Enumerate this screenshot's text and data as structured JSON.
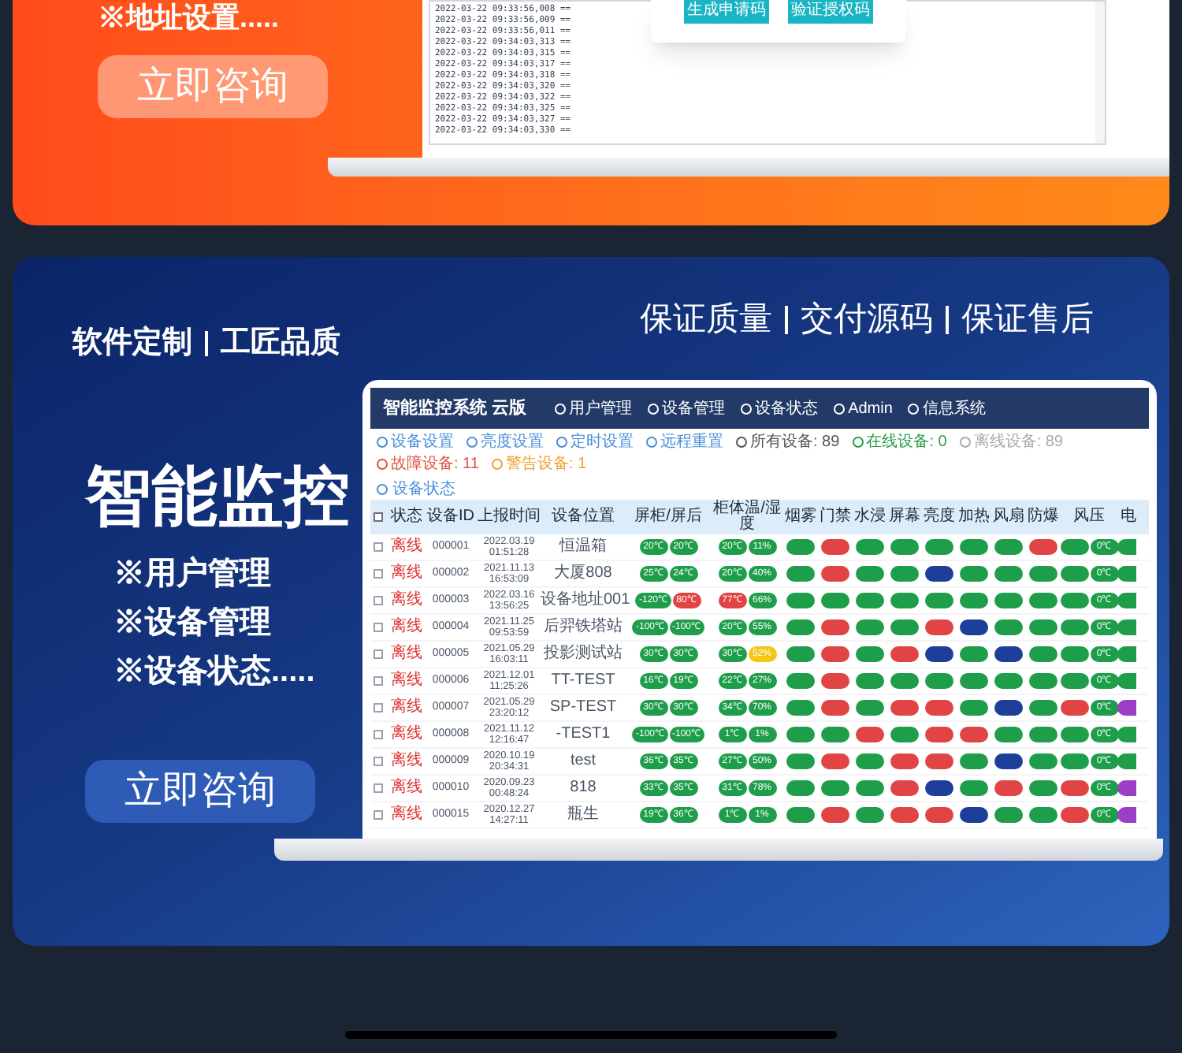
{
  "top_banner": {
    "feature_line": "※地址设置.....",
    "button": "立即咨询",
    "log_lines": [
      "2022-03-22 09:33:56,008 ==",
      "2022-03-22 09:33:56,009 ==",
      "2022-03-22 09:33:56,011 ==",
      "2022-03-22 09:34:03,313 ==",
      "2022-03-22 09:34:03,315 ==",
      "2022-03-22 09:34:03,317 ==",
      "2022-03-22 09:34:03,318 ==",
      "2022-03-22 09:34:03,320 ==",
      "2022-03-22 09:34:03,322 ==",
      "2022-03-22 09:34:03,325 ==",
      "2022-03-22 09:34:03,327 ==",
      "2022-03-22 09:34:03,330 =="
    ],
    "dialog_buttons": [
      "生成申请码",
      "验证授权码"
    ]
  },
  "blue_banner": {
    "tagline_left": [
      "软件定制",
      "工匠品质"
    ],
    "tagline_right": [
      "保证质量",
      "交付源码",
      "保证售后"
    ],
    "title": "智能监控",
    "features": [
      "※用户管理",
      "※设备管理",
      "※设备状态....."
    ],
    "button": "立即咨询",
    "app": {
      "title": "智能监控系统 云版",
      "nav": [
        "用户管理",
        "设备管理",
        "设备状态",
        "Admin",
        "信息系统"
      ],
      "toolbar": [
        {
          "label": "设备设置",
          "color": "#4a8fd9"
        },
        {
          "label": "亮度设置",
          "color": "#4a8fd9"
        },
        {
          "label": "定时设置",
          "color": "#4a8fd9"
        },
        {
          "label": "远程重置",
          "color": "#4a8fd9"
        },
        {
          "label": "所有设备: 89",
          "color": "#555555"
        },
        {
          "label": "在线设备: 0",
          "color": "#2a9d4a"
        },
        {
          "label": "离线设备: 89",
          "color": "#aaaaaa"
        },
        {
          "label": "故障设备: 11",
          "color": "#e05545"
        },
        {
          "label": "警告设备: 1",
          "color": "#f0a030"
        }
      ],
      "section": "设备状态",
      "all_checked": false,
      "columns": [
        "状态",
        "设备ID",
        "上报时间",
        "设备位置",
        "屏柜/屏后",
        "柜体温/湿度",
        "烟雾",
        "门禁",
        "水浸",
        "屏幕",
        "亮度",
        "加热",
        "风扇",
        "防爆",
        "风压",
        "电"
      ],
      "rows": [
        {
          "checked": false,
          "status": "离线",
          "id": "000001",
          "time": "2022.03.19 01:51:28",
          "location": "恒温箱",
          "temps": [
            {
              "value": "20℃",
              "color": "#1e9e4a"
            },
            {
              "value": "20℃",
              "color": "#1e9e4a"
            }
          ],
          "humid": [
            {
              "value": "20℃",
              "color": "#1e9e4a"
            },
            {
              "value": "11%",
              "color": "#1e9e4a"
            }
          ],
          "statuses": [
            {
              "color": "#1e9e4a"
            },
            {
              "color": "#e04444"
            },
            {
              "color": "#1e9e4a"
            },
            {
              "color": "#1e9e4a"
            },
            {
              "color": "#1e9e4a"
            },
            {
              "color": "#1e9e4a"
            },
            {
              "color": "#1e9e4a"
            },
            {
              "color": "#e04444"
            }
          ],
          "pressure": [
            {
              "color": "#1e9e4a"
            },
            {
              "value": "0℃",
              "color": "#1e9e4a"
            }
          ],
          "power": {
            "color": "#1e9e4a"
          }
        },
        {
          "checked": false,
          "status": "离线",
          "id": "000002",
          "time": "2021.11.13 16:53:09",
          "location": "大厦808",
          "temps": [
            {
              "value": "25℃",
              "color": "#1e9e4a"
            },
            {
              "value": "24℃",
              "color": "#1e9e4a"
            }
          ],
          "humid": [
            {
              "value": "20℃",
              "color": "#1e9e4a"
            },
            {
              "value": "40%",
              "color": "#1e9e4a"
            }
          ],
          "statuses": [
            {
              "color": "#1e9e4a"
            },
            {
              "color": "#e04444"
            },
            {
              "color": "#1e9e4a"
            },
            {
              "color": "#1e9e4a"
            },
            {
              "color": "#1d3f9a"
            },
            {
              "color": "#1e9e4a"
            },
            {
              "color": "#1e9e4a"
            },
            {
              "color": "#1e9e4a"
            }
          ],
          "pressure": [
            {
              "color": "#1e9e4a"
            },
            {
              "value": "0℃",
              "color": "#1e9e4a"
            }
          ],
          "power": {
            "color": "#1e9e4a"
          }
        },
        {
          "checked": false,
          "status": "离线",
          "id": "000003",
          "time": "2022.03.16 13:56:25",
          "location": "设备地址001",
          "temps": [
            {
              "value": "-120℃",
              "color": "#1e9e4a"
            },
            {
              "value": "80℃",
              "color": "#e04444"
            }
          ],
          "humid": [
            {
              "value": "77℃",
              "color": "#e04444"
            },
            {
              "value": "66%",
              "color": "#1e9e4a"
            }
          ],
          "statuses": [
            {
              "color": "#1e9e4a"
            },
            {
              "color": "#1e9e4a"
            },
            {
              "color": "#1e9e4a"
            },
            {
              "color": "#1e9e4a"
            },
            {
              "color": "#1e9e4a"
            },
            {
              "color": "#1e9e4a"
            },
            {
              "color": "#1e9e4a"
            },
            {
              "color": "#1e9e4a"
            }
          ],
          "pressure": [
            {
              "color": "#1e9e4a"
            },
            {
              "value": "0℃",
              "color": "#1e9e4a"
            }
          ],
          "power": {
            "color": "#1e9e4a"
          }
        },
        {
          "checked": false,
          "status": "离线",
          "id": "000004",
          "time": "2021.11.25 09:53:59",
          "location": "后羿铁塔站",
          "temps": [
            {
              "value": "-100℃",
              "color": "#1e9e4a"
            },
            {
              "value": "-100℃",
              "color": "#1e9e4a"
            }
          ],
          "humid": [
            {
              "value": "20℃",
              "color": "#1e9e4a"
            },
            {
              "value": "55%",
              "color": "#1e9e4a"
            }
          ],
          "statuses": [
            {
              "color": "#1e9e4a"
            },
            {
              "color": "#e04444"
            },
            {
              "color": "#1e9e4a"
            },
            {
              "color": "#1e9e4a"
            },
            {
              "color": "#e04444"
            },
            {
              "color": "#1d3f9a"
            },
            {
              "color": "#1e9e4a"
            },
            {
              "color": "#1e9e4a"
            }
          ],
          "pressure": [
            {
              "color": "#1e9e4a"
            },
            {
              "value": "0℃",
              "color": "#1e9e4a"
            }
          ],
          "power": {
            "color": "#1e9e4a"
          }
        },
        {
          "checked": false,
          "status": "离线",
          "id": "000005",
          "time": "2021.05.29 16:03:11",
          "location": "投影测试站",
          "temps": [
            {
              "value": "30℃",
              "color": "#1e9e4a"
            },
            {
              "value": "30℃",
              "color": "#1e9e4a"
            }
          ],
          "humid": [
            {
              "value": "30℃",
              "color": "#1e9e4a"
            },
            {
              "value": "52%",
              "color": "#f5c518"
            }
          ],
          "statuses": [
            {
              "color": "#1e9e4a"
            },
            {
              "color": "#e04444"
            },
            {
              "color": "#1e9e4a"
            },
            {
              "color": "#e04444"
            },
            {
              "color": "#1d3f9a"
            },
            {
              "color": "#1e9e4a"
            },
            {
              "color": "#1d3f9a"
            },
            {
              "color": "#1e9e4a"
            }
          ],
          "pressure": [
            {
              "color": "#1e9e4a"
            },
            {
              "value": "0℃",
              "color": "#1e9e4a"
            }
          ],
          "power": {
            "color": "#1e9e4a"
          }
        },
        {
          "checked": false,
          "status": "离线",
          "id": "000006",
          "time": "2021.12.01 11:25:26",
          "location": "TT-TEST",
          "temps": [
            {
              "value": "16℃",
              "color": "#1e9e4a"
            },
            {
              "value": "19℃",
              "color": "#1e9e4a"
            }
          ],
          "humid": [
            {
              "value": "22℃",
              "color": "#1e9e4a"
            },
            {
              "value": "27%",
              "color": "#1e9e4a"
            }
          ],
          "statuses": [
            {
              "color": "#1e9e4a"
            },
            {
              "color": "#e04444"
            },
            {
              "color": "#1e9e4a"
            },
            {
              "color": "#1e9e4a"
            },
            {
              "color": "#1e9e4a"
            },
            {
              "color": "#1e9e4a"
            },
            {
              "color": "#1e9e4a"
            },
            {
              "color": "#1e9e4a"
            }
          ],
          "pressure": [
            {
              "color": "#1e9e4a"
            },
            {
              "value": "0℃",
              "color": "#1e9e4a"
            }
          ],
          "power": {
            "color": "#1e9e4a"
          }
        },
        {
          "checked": false,
          "status": "离线",
          "id": "000007",
          "time": "2021.05.29 23:20:12",
          "location": "SP-TEST",
          "temps": [
            {
              "value": "30℃",
              "color": "#1e9e4a"
            },
            {
              "value": "30℃",
              "color": "#1e9e4a"
            }
          ],
          "humid": [
            {
              "value": "34℃",
              "color": "#1e9e4a"
            },
            {
              "value": "70%",
              "color": "#1e9e4a"
            }
          ],
          "statuses": [
            {
              "color": "#1e9e4a"
            },
            {
              "color": "#e04444"
            },
            {
              "color": "#1e9e4a"
            },
            {
              "color": "#e04444"
            },
            {
              "color": "#e04444"
            },
            {
              "color": "#1e9e4a"
            },
            {
              "color": "#1d3f9a"
            },
            {
              "color": "#1e9e4a"
            }
          ],
          "pressure": [
            {
              "color": "#e04444"
            },
            {
              "value": "0℃",
              "color": "#1e9e4a"
            }
          ],
          "power": {
            "color": "#9b3fc6"
          }
        },
        {
          "checked": false,
          "status": "离线",
          "id": "000008",
          "time": "2021.11.12 12:16:47",
          "location": "-TEST1",
          "temps": [
            {
              "value": "-100℃",
              "color": "#1e9e4a"
            },
            {
              "value": "-100℃",
              "color": "#1e9e4a"
            }
          ],
          "humid": [
            {
              "value": "1℃",
              "color": "#1e9e4a"
            },
            {
              "value": "1%",
              "color": "#1e9e4a"
            }
          ],
          "statuses": [
            {
              "color": "#1e9e4a"
            },
            {
              "color": "#1e9e4a"
            },
            {
              "color": "#e04444"
            },
            {
              "color": "#1e9e4a"
            },
            {
              "color": "#e04444"
            },
            {
              "color": "#e04444"
            },
            {
              "color": "#1e9e4a"
            },
            {
              "color": "#1e9e4a"
            }
          ],
          "pressure": [
            {
              "color": "#1e9e4a"
            },
            {
              "value": "0℃",
              "color": "#1e9e4a"
            }
          ],
          "power": {
            "color": "#1e9e4a"
          }
        },
        {
          "checked": false,
          "status": "离线",
          "id": "000009",
          "time": "2020.10.19 20:34:31",
          "location": "test",
          "temps": [
            {
              "value": "36℃",
              "color": "#1e9e4a"
            },
            {
              "value": "35℃",
              "color": "#1e9e4a"
            }
          ],
          "humid": [
            {
              "value": "27℃",
              "color": "#1e9e4a"
            },
            {
              "value": "50%",
              "color": "#1e9e4a"
            }
          ],
          "statuses": [
            {
              "color": "#1e9e4a"
            },
            {
              "color": "#e04444"
            },
            {
              "color": "#1e9e4a"
            },
            {
              "color": "#e04444"
            },
            {
              "color": "#e04444"
            },
            {
              "color": "#1e9e4a"
            },
            {
              "color": "#1d3f9a"
            },
            {
              "color": "#1e9e4a"
            }
          ],
          "pressure": [
            {
              "color": "#1e9e4a"
            },
            {
              "value": "0℃",
              "color": "#1e9e4a"
            }
          ],
          "power": {
            "color": "#1e9e4a"
          }
        },
        {
          "checked": false,
          "status": "离线",
          "id": "000010",
          "time": "2020.09.23 00:48:24",
          "location": "818",
          "temps": [
            {
              "value": "33℃",
              "color": "#1e9e4a"
            },
            {
              "value": "35℃",
              "color": "#1e9e4a"
            }
          ],
          "humid": [
            {
              "value": "31℃",
              "color": "#1e9e4a"
            },
            {
              "value": "78%",
              "color": "#1e9e4a"
            }
          ],
          "statuses": [
            {
              "color": "#1e9e4a"
            },
            {
              "color": "#1e9e4a"
            },
            {
              "color": "#1e9e4a"
            },
            {
              "color": "#e04444"
            },
            {
              "color": "#1d3f9a"
            },
            {
              "color": "#1e9e4a"
            },
            {
              "color": "#e04444"
            },
            {
              "color": "#1e9e4a"
            }
          ],
          "pressure": [
            {
              "color": "#e04444"
            },
            {
              "value": "0℃",
              "color": "#1e9e4a"
            }
          ],
          "power": {
            "color": "#9b3fc6"
          }
        },
        {
          "checked": false,
          "status": "离线",
          "id": "000015",
          "time": "2020.12.27 14:27:11",
          "location": "瓶生",
          "temps": [
            {
              "value": "19℃",
              "color": "#1e9e4a"
            },
            {
              "value": "36℃",
              "color": "#1e9e4a"
            }
          ],
          "humid": [
            {
              "value": "1℃",
              "color": "#1e9e4a"
            },
            {
              "value": "1%",
              "color": "#1e9e4a"
            }
          ],
          "statuses": [
            {
              "color": "#1e9e4a"
            },
            {
              "color": "#e04444"
            },
            {
              "color": "#1e9e4a"
            },
            {
              "color": "#e04444"
            },
            {
              "color": "#e04444"
            },
            {
              "color": "#1d3f9a"
            },
            {
              "color": "#1e9e4a"
            },
            {
              "color": "#1e9e4a"
            }
          ],
          "pressure": [
            {
              "color": "#e04444"
            },
            {
              "value": "0℃",
              "color": "#1e9e4a"
            }
          ],
          "power": {
            "color": "#9b3fc6"
          }
        }
      ]
    }
  }
}
